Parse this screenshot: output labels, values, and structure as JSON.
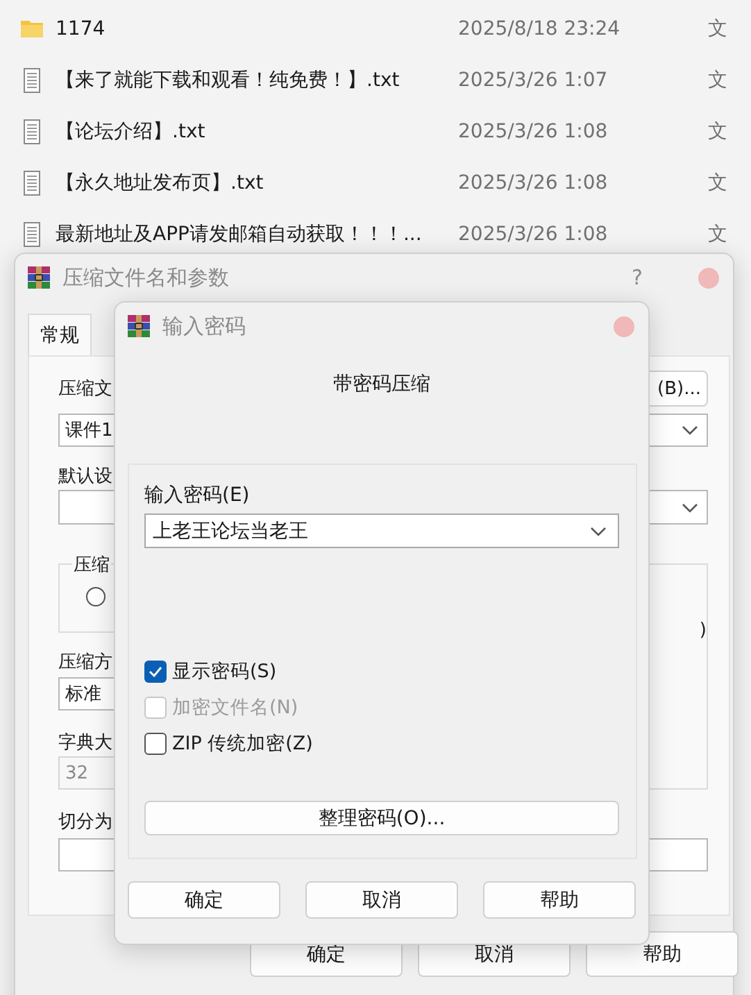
{
  "file_list": {
    "rows": [
      {
        "kind": "folder",
        "name": "1174",
        "modified": "2025/8/18 23:24",
        "type": "文"
      },
      {
        "kind": "text",
        "name": "【来了就能下载和观看！纯免费！】.txt",
        "modified": "2025/3/26 1:07",
        "type": "文"
      },
      {
        "kind": "text",
        "name": "【论坛介绍】.txt",
        "modified": "2025/3/26 1:08",
        "type": "文"
      },
      {
        "kind": "text",
        "name": "【永久地址发布页】.txt",
        "modified": "2025/3/26 1:08",
        "type": "文"
      },
      {
        "kind": "text",
        "name": "最新地址及APP请发邮箱自动获取！！！...",
        "modified": "2025/3/26 1:08",
        "type": "文"
      }
    ]
  },
  "archive_dialog": {
    "title": "压缩文件名和参数",
    "help_button": "?",
    "tabs": [
      {
        "label": "常规",
        "selected": true
      }
    ],
    "archive_name": {
      "label": "压缩文",
      "value": "课件1"
    },
    "browse_button": "(B)...",
    "profile": {
      "label": "默认设"
    },
    "format_group": {
      "legend": "压缩",
      "radio_selected": false
    },
    "radio_label_tail": ")",
    "method": {
      "label": "压缩方",
      "value": "标准"
    },
    "dictionary": {
      "label": "字典大",
      "value": "32",
      "disabled": true
    },
    "split": {
      "label": "切分为"
    },
    "buttons": [
      "确定",
      "取消",
      "帮助"
    ]
  },
  "password_dialog": {
    "title": "输入密码",
    "heading": "带密码压缩",
    "password": {
      "label": "输入密码(E)",
      "value": "上老王论坛当老王"
    },
    "options": [
      {
        "label": "显示密码(S)",
        "checked": true,
        "disabled": false
      },
      {
        "label": "加密文件名(N)",
        "checked": false,
        "disabled": true
      },
      {
        "label": "ZIP 传统加密(Z)",
        "checked": false,
        "disabled": false
      }
    ],
    "organize_button": "整理密码(O)...",
    "buttons": [
      "确定",
      "取消",
      "帮助"
    ]
  }
}
